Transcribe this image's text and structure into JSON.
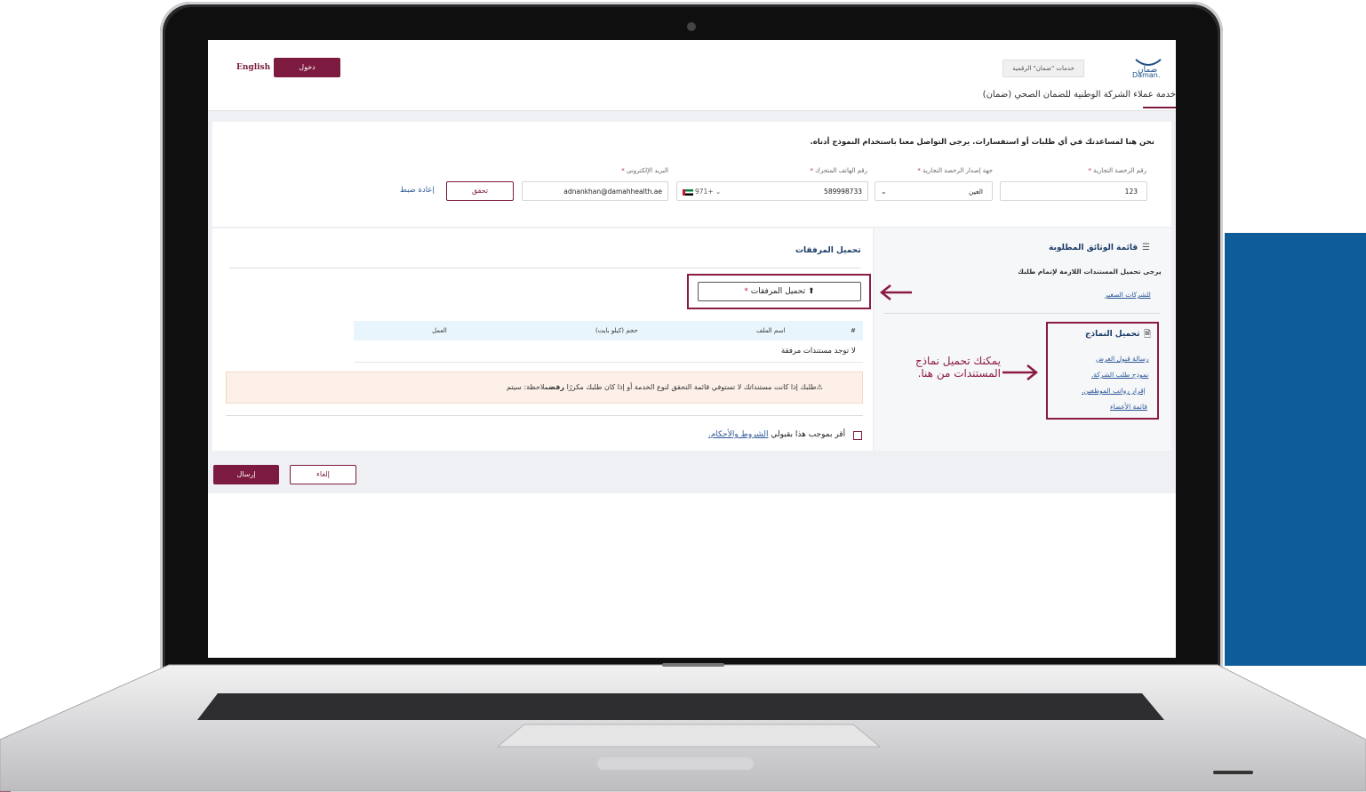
{
  "header": {
    "language_toggle": "English",
    "login_label": "دخول",
    "digital_services_label": "خدمات \"ضمان\" الرقمية",
    "logo_text": "Daman."
  },
  "tab": {
    "title": "خدمة عملاء الشركة الوطنية للضمان الصحي (ضمان)"
  },
  "form": {
    "intro": "نحن هنا لمساعدتك في أي طلبات أو استفسارات. يرجى التواصل معنا باستخدام النموذج أدناه.",
    "trade_license_label": "رقم الرخصة التجارية",
    "trade_license_value": "123",
    "issuer_label": "جهة إصدار الرخصة التجارية",
    "issuer_value": "العين",
    "phone_label": "رقم الهاتف المتحرك",
    "phone_code": "971+",
    "phone_value": "589998733",
    "email_label": "البريد الإلكتروني",
    "email_value": "adnankhan@damahhealth.ae",
    "required_mark": "*",
    "verify_label": "تحقق",
    "reset_label": "إعادة ضبط"
  },
  "upload": {
    "title": "تحميل المرفقات",
    "button_label": "تحميل المرفقات",
    "table": {
      "headers": [
        "#",
        "اسم الملف",
        "حجم (كيلو بايت)",
        "العمل"
      ],
      "empty_text": "لا توجد مستندات مرفقة"
    },
    "alert_text": "طلبك إذا كانت مستنداتك لا تستوفي قائمة التحقق لنوع الخدمة أو إذا كان طلبك مكررًا",
    "alert_bold": "رفض",
    "alert_note": "ملاحظة: سيتم",
    "terms_text": "أقر بموجب هذا بقبولي",
    "terms_link": "الشروط والأحكام."
  },
  "required_docs": {
    "title": "قائمة الوثائق المطلوبة",
    "description": "يرجى تحميل المستندات اللازمة لإتمام طلبك",
    "category_link": "للشركات الصغير"
  },
  "templates": {
    "title": "تحميل النماذج",
    "links": [
      "رسالة قبول العرض",
      "نموذج طلب الشركة.",
      "إقرار رواتب الموظفين.",
      "قائمة الأعضاء"
    ]
  },
  "callout": {
    "text": "يمكنك تحميل نماذج المستندات من هنا.",
    "color": "#8b1a44"
  },
  "footer": {
    "submit_label": "إرسال",
    "cancel_label": "إلغاء"
  },
  "colors": {
    "brand": "#7d1a3f",
    "link": "#2b5797",
    "background_panel": "#0e5c9a"
  }
}
